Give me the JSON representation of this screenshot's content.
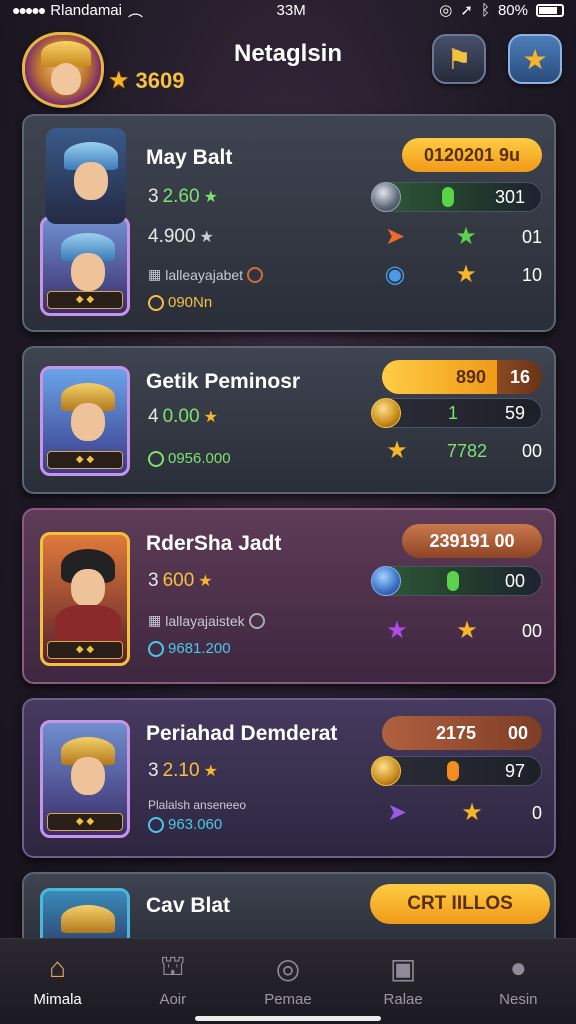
{
  "status_bar": {
    "carrier": "Rlandamai",
    "time": "33M",
    "battery": "80%"
  },
  "header": {
    "title": "Netaglsin",
    "coins": "3609"
  },
  "cards": [
    {
      "name": "May Balt",
      "stat1": "3",
      "stat1_value": "2.60",
      "stat2": "4.900",
      "extra_label": "lalleayajabet",
      "coin_value": "090Nn",
      "pill": "0120201 9u",
      "bar_value": "301",
      "row2_value": "01",
      "row3_value": "10"
    },
    {
      "name": "Getik Peminosr",
      "stat1": "4",
      "stat1_value": "0.00",
      "coin_value": "0956.000",
      "pill_left": "890",
      "pill_right": "16",
      "bar_mid": "1",
      "bar_value": "59",
      "row2_mid": "7782",
      "row2_value": "00"
    },
    {
      "name": "RderSha Jadt",
      "stat1": "3",
      "stat1_value": "600",
      "extra_label": "lallayajaistek",
      "coin_value": "9681.200",
      "pill": "239191 00",
      "bar_value": "00",
      "row2_value": "00"
    },
    {
      "name": "Periahad Demderat",
      "stat1": "3",
      "stat1_value": "2.10",
      "extra_label": "Plalalsh anseneeo",
      "coin_value": "963.060",
      "pill_left": "2175",
      "pill_right": "00",
      "bar_value": "97",
      "row2_value": "0"
    },
    {
      "name": "Cav Blat",
      "pill": "CRT IILLOS"
    }
  ],
  "tabs": [
    {
      "label": "Mimala",
      "icon": "home-icon",
      "active": true
    },
    {
      "label": "Aoir",
      "icon": "shop-icon",
      "active": false
    },
    {
      "label": "Pemae",
      "icon": "target-icon",
      "active": false
    },
    {
      "label": "Ralae",
      "icon": "camera-icon",
      "active": false
    },
    {
      "label": "Nesin",
      "icon": "user-icon",
      "active": false
    }
  ],
  "colors": {
    "accent_gold": "#f7b62a",
    "accent_green": "#7de36d",
    "card_bg": "#3e4450",
    "card_purple": "#5e3b56"
  }
}
